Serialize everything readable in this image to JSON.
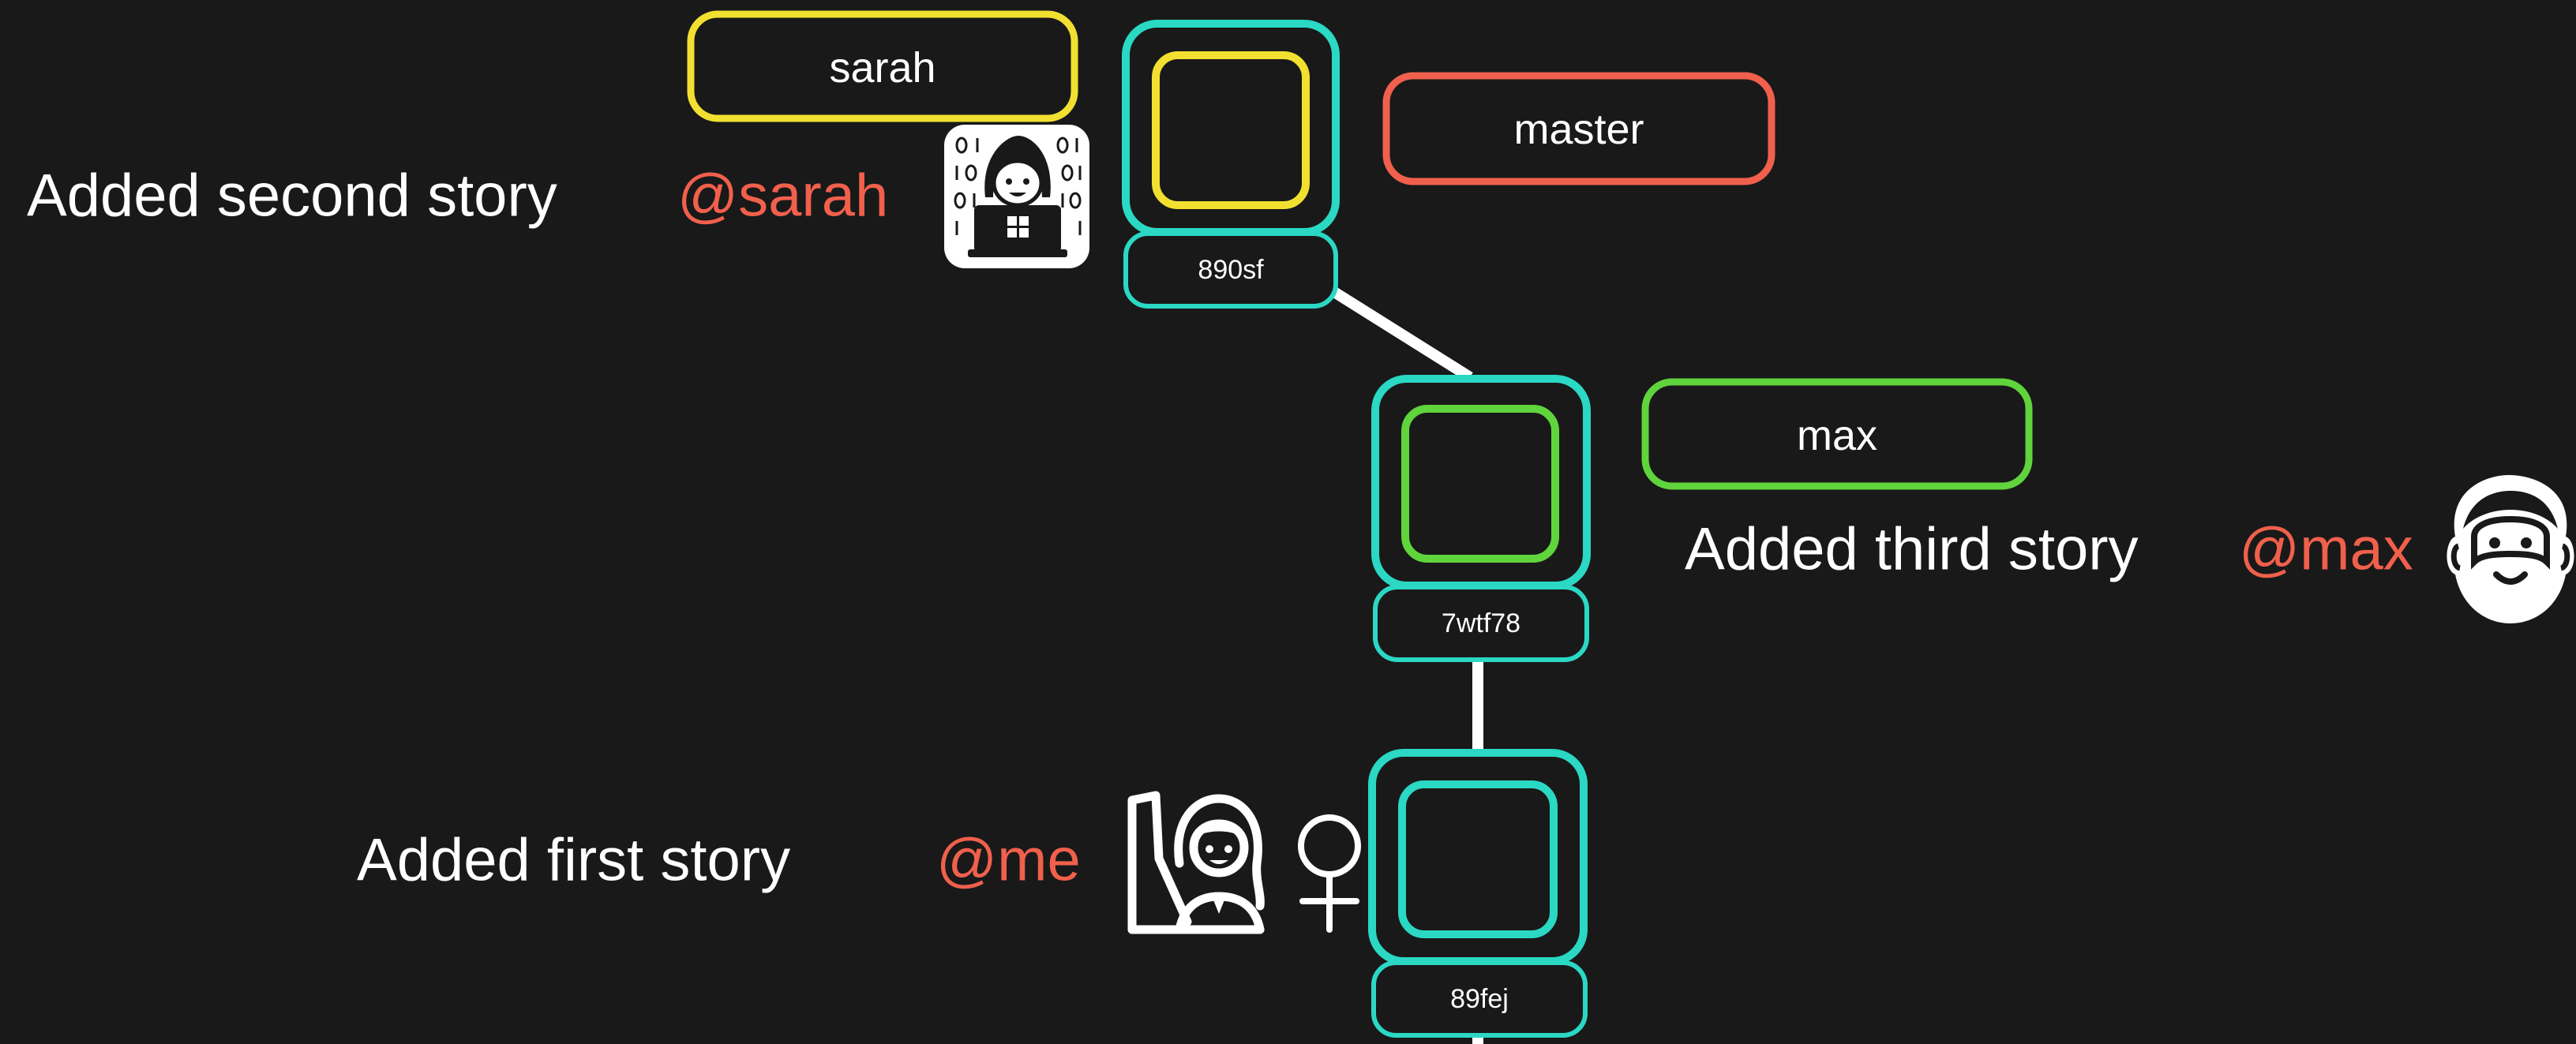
{
  "colors": {
    "background": "#191919",
    "commit_border": "#2ad8c4",
    "branch_sarah": "#f2e030",
    "branch_master": "#f0604c",
    "branch_max": "#5fd43c",
    "author": "#f0604c",
    "text": "#ffffff",
    "line": "#ffffff"
  },
  "branches": {
    "sarah": "sarah",
    "master": "master",
    "max": "max"
  },
  "commits": [
    {
      "hash": "890sf",
      "message": "Added second story",
      "author": "@sarah",
      "avatar_icon": "woman-technologist-icon"
    },
    {
      "hash": "7wtf78",
      "message": "Added third story",
      "author": "@max",
      "avatar_icon": "bearded-man-icon"
    },
    {
      "hash": "89fej",
      "message": "Added first story",
      "author": "@me",
      "avatar_icon": "woman-raising-hand-icon"
    }
  ],
  "icons": {
    "female_sign": "female-sign-icon"
  }
}
